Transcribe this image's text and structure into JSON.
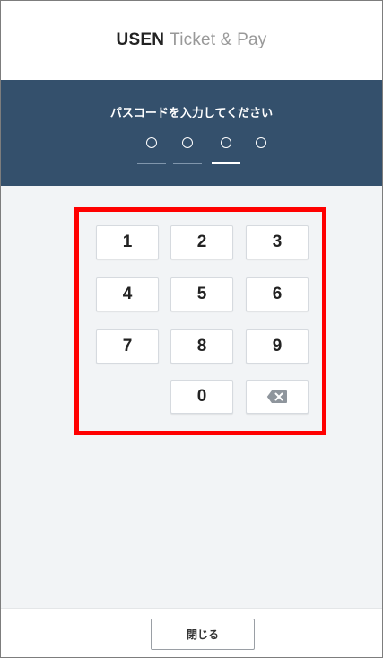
{
  "header": {
    "brand_bold": "USEN",
    "brand_light": "Ticket & Pay"
  },
  "passcode": {
    "prompt": "パスコードを入力してください",
    "total_digits": 4,
    "entered_digits": 0,
    "active_slot": 3
  },
  "keypad": {
    "keys": [
      "1",
      "2",
      "3",
      "4",
      "5",
      "6",
      "7",
      "8",
      "9",
      "0"
    ],
    "backspace_icon": "backspace-icon"
  },
  "footer": {
    "close_label": "閉じる"
  },
  "colors": {
    "panel_bg": "#34506c",
    "page_bg": "#f2f4f6",
    "highlight": "#ff0000"
  }
}
